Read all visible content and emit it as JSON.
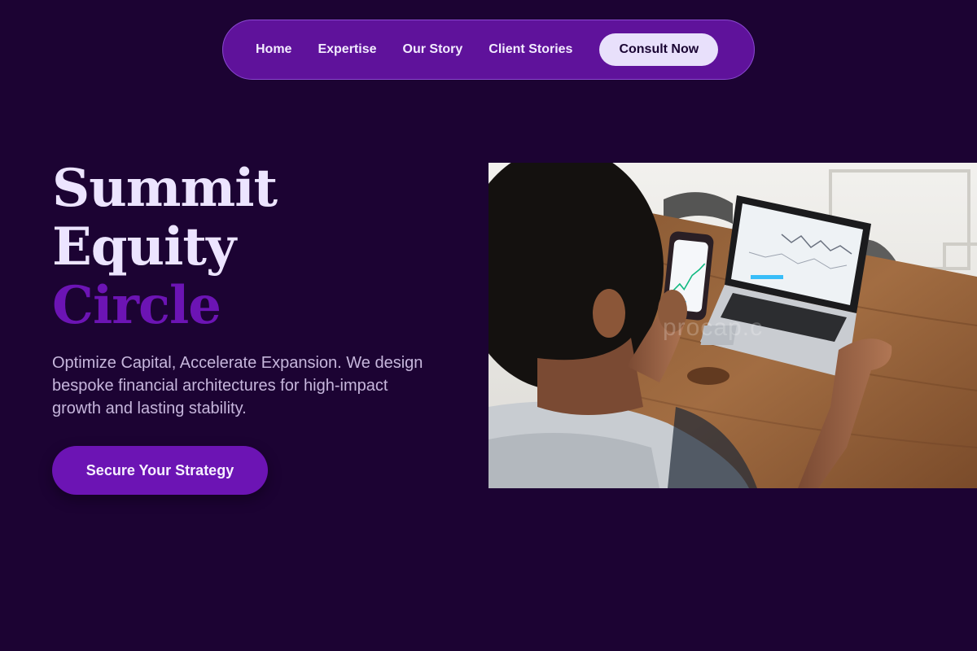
{
  "nav": {
    "links": [
      "Home",
      "Expertise",
      "Our Story",
      "Client Stories"
    ],
    "cta_label": "Consult Now"
  },
  "hero": {
    "title_lines": [
      "Summit",
      "Equity",
      "Circle"
    ],
    "subtitle": "Optimize Capital, Accelerate Expansion. We design bespoke financial architectures for high-impact growth and lasting stability.",
    "cta_label": "Secure Your Strategy",
    "image": {
      "watermark": "procap.c",
      "alt_subject": "person at wooden desk holding phone with stock chart, laptop showing trading charts"
    }
  },
  "colors": {
    "background": "#1c0333",
    "nav_pill": "#5f129b",
    "accent": "#6c14b4",
    "title_light": "#ece4ff",
    "cta_light": "#e8e0fb"
  }
}
